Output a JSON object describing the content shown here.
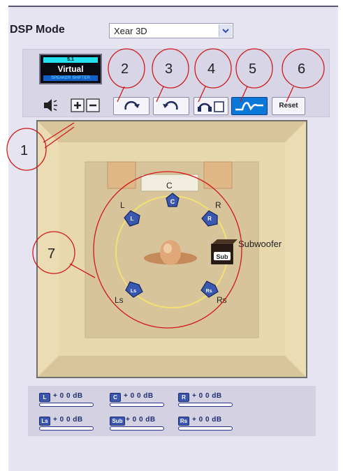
{
  "header": {
    "dsp_mode_label": "DSP Mode",
    "dsp_mode_value": "Xear 3D"
  },
  "logo": {
    "line1": "5.1",
    "line2": "Virtual",
    "line3": "SPEAKER SHIFTER"
  },
  "toolbar": {
    "reset_label": "Reset"
  },
  "callouts": [
    "1",
    "2",
    "3",
    "4",
    "5",
    "6",
    "7"
  ],
  "speakers": {
    "center": "C",
    "left": "L",
    "right": "R",
    "left_surround": "Ls",
    "right_surround": "Rs",
    "subwoofer": "Subwoofer",
    "sub_badge": "Sub"
  },
  "levels": [
    {
      "icon": "L",
      "value": "+ 0 0 dB"
    },
    {
      "icon": "C",
      "value": "+ 0 0 dB"
    },
    {
      "icon": "R",
      "value": "+ 0 0 dB"
    },
    {
      "icon": "Ls",
      "value": "+ 0 0 dB"
    },
    {
      "icon": "Sub",
      "value": "+ 0 0 dB"
    },
    {
      "icon": "Rs",
      "value": "+ 0 0 dB"
    }
  ],
  "colors": {
    "accent": "#26308a",
    "callout": "#d01818",
    "room": "#e2d2a8",
    "speaker": "#3a58b0",
    "ring": "#f4e070"
  }
}
